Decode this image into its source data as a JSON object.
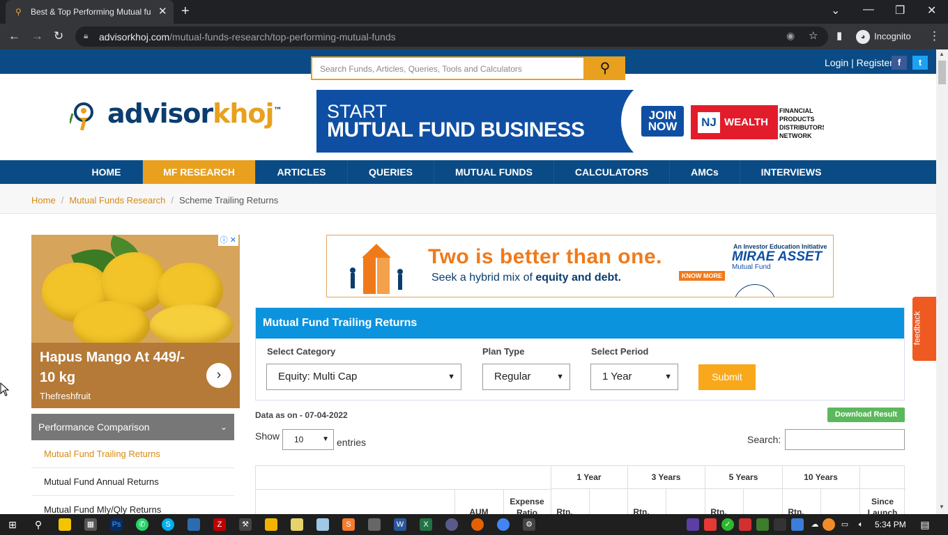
{
  "browser": {
    "tab_title": "Best & Top Performing Mutual fu",
    "url_domain": "advisorkhoj.com",
    "url_path": "/mutual-funds-research/top-performing-mutual-funds",
    "incognito_label": "Incognito"
  },
  "header": {
    "search_placeholder": "Search Funds, Articles, Queries, Tools and Calculators",
    "login_label": "Login | Register",
    "facebook": "f",
    "twitter": "t"
  },
  "logo": {
    "part1": "advisor",
    "part2": "khoj",
    "tm": "™"
  },
  "banner": {
    "line1": "START",
    "line2": "MUTUAL FUND BUSINESS",
    "join_line1": "JOIN",
    "join_line2": "NOW",
    "nj": "NJ",
    "wealth": "WEALTH",
    "fp_line1": "FINANCIAL",
    "fp_line2": "PRODUCTS",
    "fp_line3": "DISTRIBUTORS",
    "fp_line4": "NETWORK"
  },
  "nav": {
    "items": [
      {
        "label": "HOME"
      },
      {
        "label": "MF RESEARCH"
      },
      {
        "label": "ARTICLES"
      },
      {
        "label": "QUERIES"
      },
      {
        "label": "MUTUAL FUNDS"
      },
      {
        "label": "CALCULATORS"
      },
      {
        "label": "AMCs"
      },
      {
        "label": "INTERVIEWS"
      }
    ]
  },
  "breadcrumb": {
    "home": "Home",
    "research": "Mutual Funds Research",
    "current": "Scheme Trailing Returns"
  },
  "left_ad": {
    "headline": "Hapus Mango At 449/- 10 kg",
    "source": "Thefreshfruit"
  },
  "left_menu": {
    "header": "Performance Comparison",
    "items": [
      {
        "label": "Mutual Fund Trailing Returns"
      },
      {
        "label": "Mutual Fund Annual Returns"
      },
      {
        "label": "Mutual Fund Mly/Qly Returns"
      }
    ]
  },
  "center_ad": {
    "headline": "Two is better than one.",
    "sub_prefix": "Seek a hybrid mix of ",
    "sub_bold": "equity and debt.",
    "know_more": "KNOW MORE",
    "initiative": "An Investor Education Initiative",
    "brand": "MIRAE ASSET",
    "brand_sub": "Mutual Fund"
  },
  "panel": {
    "title": "Mutual Fund Trailing Returns",
    "category_label": "Select Category",
    "category_value": "Equity: Multi Cap",
    "plan_label": "Plan Type",
    "plan_value": "Regular",
    "period_label": "Select Period",
    "period_value": "1 Year",
    "submit": "Submit"
  },
  "results": {
    "data_as_on": "Data as on - 07-04-2022",
    "download": "Download Result",
    "show": "Show",
    "length_value": "10",
    "entries": "entries",
    "search_label": "Search:"
  },
  "table": {
    "group_headers": [
      "1 Year",
      "3 Years",
      "5 Years",
      "10 Years"
    ],
    "sub_headers": {
      "aum": "AUM",
      "expense_1": "Expense",
      "expense_2": "Ratio",
      "rtn": "Rtn.",
      "since_1": "Since",
      "since_2": "Launch"
    }
  },
  "feedback": "feedback",
  "taskbar": {
    "clock": "5:34 PM"
  }
}
